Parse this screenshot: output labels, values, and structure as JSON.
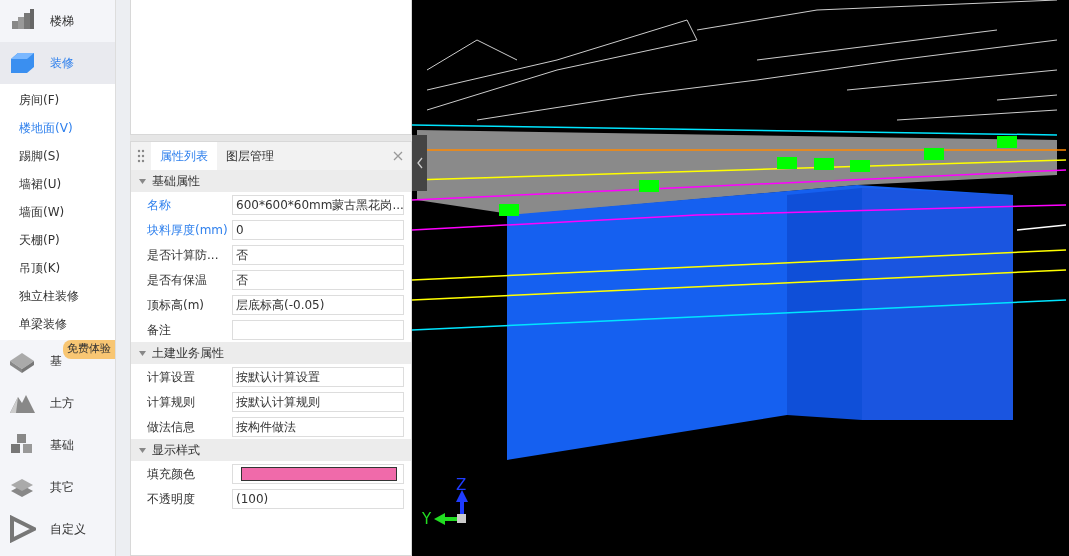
{
  "sidebar": {
    "categories": [
      {
        "label": "楼梯",
        "selected": false
      },
      {
        "label": "装修",
        "selected": true,
        "children": [
          {
            "label": "房间(F)",
            "selected": false
          },
          {
            "label": "楼地面(V)",
            "selected": true
          },
          {
            "label": "踢脚(S)",
            "selected": false
          },
          {
            "label": "墙裙(U)",
            "selected": false
          },
          {
            "label": "墙面(W)",
            "selected": false
          },
          {
            "label": "天棚(P)",
            "selected": false
          },
          {
            "label": "吊顶(K)",
            "selected": false
          },
          {
            "label": "独立柱装修",
            "selected": false
          },
          {
            "label": "单梁装修",
            "selected": false
          }
        ]
      },
      {
        "label": "基",
        "selected": false,
        "badge": "免费体验"
      },
      {
        "label": "土方",
        "selected": false
      },
      {
        "label": "基础",
        "selected": false
      },
      {
        "label": "其它",
        "selected": false
      },
      {
        "label": "自定义",
        "selected": false
      }
    ]
  },
  "properties": {
    "tabs": [
      {
        "label": "属性列表",
        "selected": true
      },
      {
        "label": "图层管理",
        "selected": false
      }
    ],
    "groups": [
      {
        "title": "基础属性",
        "expanded": true,
        "rows": [
          {
            "label": "名称",
            "highlighted": true,
            "kind": "text",
            "value": "600*600*60mm蒙古黑花岗..."
          },
          {
            "label": "块料厚度(mm)",
            "highlighted": true,
            "kind": "text",
            "value": "0"
          },
          {
            "label": "是否计算防...",
            "highlighted": false,
            "kind": "text",
            "value": "否"
          },
          {
            "label": "是否有保温",
            "highlighted": false,
            "kind": "text",
            "value": "否"
          },
          {
            "label": "顶标高(m)",
            "highlighted": false,
            "kind": "text",
            "value": "层底标高(-0.05)"
          },
          {
            "label": "备注",
            "highlighted": false,
            "kind": "text"
          }
        ]
      },
      {
        "title": "土建业务属性",
        "expanded": true,
        "rows": [
          {
            "label": "计算设置",
            "highlighted": false,
            "kind": "text",
            "value": "按默认计算设置"
          },
          {
            "label": "计算规则",
            "highlighted": false,
            "kind": "text",
            "value": "按默认计算规则"
          },
          {
            "label": "做法信息",
            "highlighted": false,
            "kind": "text",
            "value": "按构件做法"
          }
        ]
      },
      {
        "title": "显示样式",
        "expanded": true,
        "rows": [
          {
            "label": "填充颜色",
            "highlighted": false,
            "kind": "color",
            "color": "#f06aaa"
          },
          {
            "label": "不透明度",
            "highlighted": false,
            "kind": "text",
            "value": "(100)"
          }
        ]
      }
    ]
  },
  "viewport": {
    "axes": [
      {
        "label": "Z",
        "color": "#1f3cff"
      },
      {
        "label": "Y",
        "color": "#22dd22"
      }
    ]
  }
}
